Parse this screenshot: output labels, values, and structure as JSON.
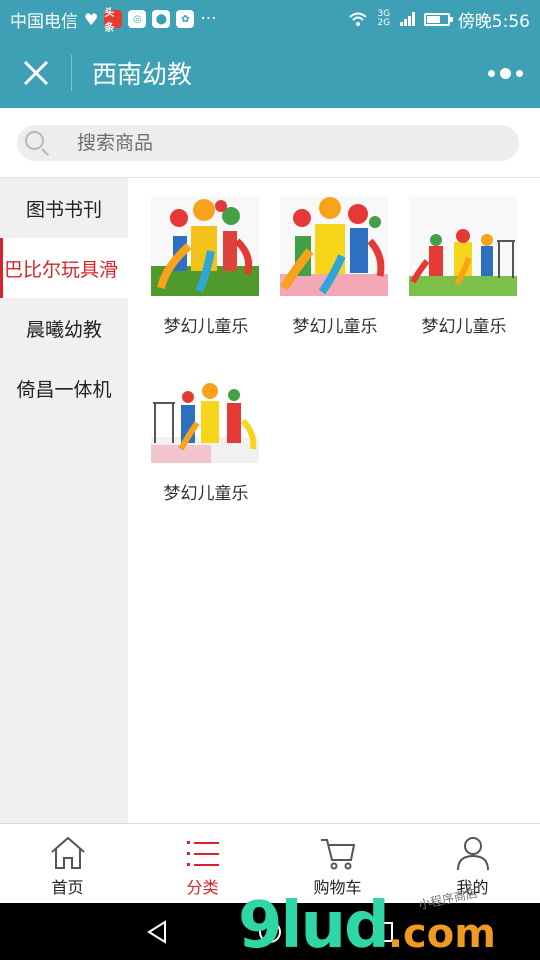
{
  "status_bar": {
    "carrier": "中国电信",
    "app_icon_1": "头条",
    "time": "傍晚5:56",
    "network": "3G 2G",
    "icons": [
      "heart-icon",
      "news-app-icon",
      "weibo-icon",
      "map-pin-icon",
      "baidu-paw-icon",
      "more-dots-icon",
      "wifi-icon",
      "signal-icon",
      "battery-icon"
    ]
  },
  "header": {
    "title": "西南幼教",
    "close_icon": "close-icon",
    "more_icon": "more-dots-icon"
  },
  "search": {
    "placeholder": "搜索商品"
  },
  "sidebar": {
    "categories": [
      {
        "label": "图书书刊",
        "active": false
      },
      {
        "label": "巴比尔玩具滑",
        "active": true
      },
      {
        "label": "晨曦幼教",
        "active": false
      },
      {
        "label": "倚昌一体机",
        "active": false
      }
    ]
  },
  "products": [
    {
      "name": "梦幻儿童乐"
    },
    {
      "name": "梦幻儿童乐"
    },
    {
      "name": "梦幻儿童乐"
    },
    {
      "name": "梦幻儿童乐"
    }
  ],
  "tabbar": {
    "tabs": [
      {
        "label": "首页",
        "icon": "home-icon",
        "active": false
      },
      {
        "label": "分类",
        "icon": "list-icon",
        "active": true
      },
      {
        "label": "购物车",
        "icon": "cart-icon",
        "active": false
      },
      {
        "label": "我的",
        "icon": "user-icon",
        "active": false
      }
    ]
  },
  "watermark": {
    "main": "9lud",
    "suffix": ".com",
    "handwritten": "小程序商店"
  },
  "colors": {
    "header_bg": "#3ea0b5",
    "accent_red": "#d9232a",
    "sidebar_bg": "#f0f0f0"
  }
}
